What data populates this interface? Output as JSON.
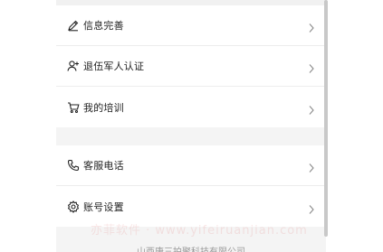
{
  "menu_group_1": [
    {
      "label": "信息完善",
      "icon": "edit-icon"
    },
    {
      "label": "退伍军人认证",
      "icon": "user-add-icon"
    },
    {
      "label": "我的培训",
      "icon": "cart-icon"
    }
  ],
  "menu_group_2": [
    {
      "label": "客服电话",
      "icon": "phone-icon"
    },
    {
      "label": "账号设置",
      "icon": "settings-icon"
    }
  ],
  "watermark": "亦菲软件 · www.yifeiruanjian.com",
  "footer": "山西唐三拍聚科技有限公司",
  "colors": {
    "background": "#f4f4f4",
    "card": "#ffffff",
    "text": "#222222",
    "chevron": "#8a8a8a"
  }
}
